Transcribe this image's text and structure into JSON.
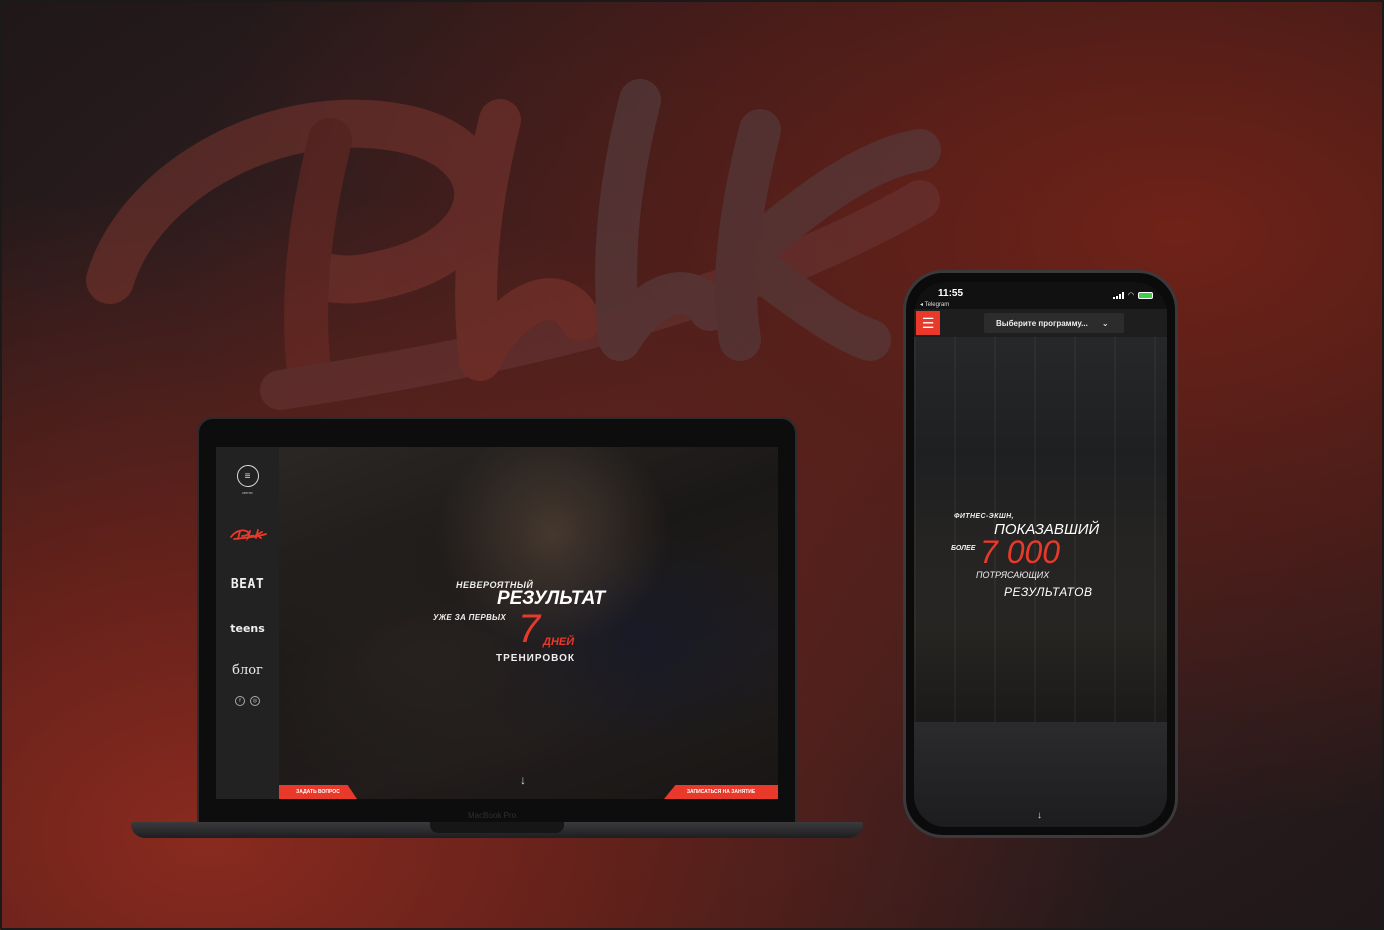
{
  "brand": {
    "watermark": "Rbk",
    "accent_color": "#e8392a"
  },
  "laptop": {
    "device_label": "MacBook Pro",
    "sidebar": {
      "menu_label": "меню",
      "items": [
        {
          "label": "Rbk",
          "icon": "rbk-logo"
        },
        {
          "label": "BEAT",
          "icon": "beat-logo"
        },
        {
          "label": "teens",
          "icon": "teens-logo"
        },
        {
          "label": "блог",
          "icon": "blog-link"
        }
      ],
      "socials": [
        "facebook-icon",
        "instagram-icon"
      ]
    },
    "hero": {
      "line1": "НЕВЕРОЯТНЫЙ",
      "line2": "РЕЗУЛЬТАТ",
      "line3": "УЖЕ ЗА ПЕРВЫХ",
      "number": "7",
      "line4": "ДНЕЙ",
      "line5": "ТРЕНИРОВОК"
    },
    "scroll_arrow": "↓",
    "ask_button": "ЗАДАТЬ ВОПРОС",
    "signup_button": "ЗАПИСАТЬСЯ НА ЗАНЯТИЕ"
  },
  "phone": {
    "status": {
      "time": "11:55",
      "back": "◂ Telegram"
    },
    "menu_icon": "☰",
    "program_select": {
      "value": "Выберите программу..."
    },
    "hero": {
      "line1": "ФИТНЕС-ЭКШН,",
      "line2": "ПОКАЗАВШИЙ",
      "line3": "БОЛЕЕ",
      "number": "7 000",
      "line4": "ПОТРЯСАЮЩИХ",
      "line5": "РЕЗУЛЬТАТОВ"
    },
    "scroll_arrow": "↓"
  }
}
